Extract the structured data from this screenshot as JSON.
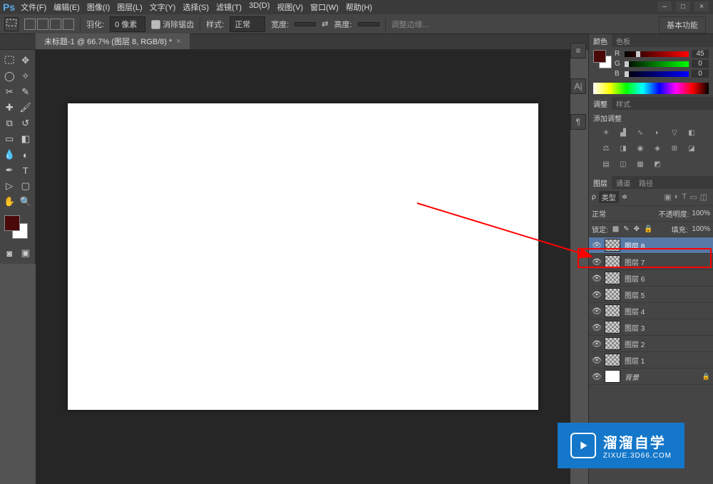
{
  "app": {
    "logo": "Ps"
  },
  "menu": {
    "file": "文件(F)",
    "edit": "编辑(E)",
    "image": "图像(I)",
    "layer": "图层(L)",
    "type": "文字(Y)",
    "select": "选择(S)",
    "filter": "滤镜(T)",
    "threed": "3D(D)",
    "view": "视图(V)",
    "window": "窗口(W)",
    "help": "帮助(H)"
  },
  "options": {
    "feather_label": "羽化:",
    "feather_value": "0 像素",
    "antialias": "消除锯齿",
    "style_label": "样式:",
    "style_value": "正常",
    "width_label": "宽度:",
    "height_label": "高度:",
    "refine": "调整边缘...",
    "essentials": "基本功能"
  },
  "document": {
    "tab_title": "未标题-1 @ 66.7% (图层 8, RGB/8) *",
    "close": "×"
  },
  "color_panel": {
    "tab_color": "颜色",
    "tab_swatches": "色板",
    "r": "R",
    "r_val": "45",
    "g": "G",
    "g_val": "0",
    "b": "B",
    "b_val": "0"
  },
  "adjust_panel": {
    "tab_adjust": "调整",
    "tab_style": "样式",
    "title": "添加调整"
  },
  "layers_panel": {
    "tab_layers": "图层",
    "tab_channels": "通道",
    "tab_paths": "路径",
    "kind_label": "类型",
    "blend_mode": "正常",
    "opacity_label": "不透明度:",
    "opacity_value": "100%",
    "lock_label": "锁定:",
    "fill_label": "填充:",
    "fill_value": "100%",
    "layers": [
      {
        "name": "图层 8",
        "selected": true
      },
      {
        "name": "图层 7",
        "selected": false
      },
      {
        "name": "图层 6",
        "selected": false
      },
      {
        "name": "图层 5",
        "selected": false
      },
      {
        "name": "图层 4",
        "selected": false
      },
      {
        "name": "图层 3",
        "selected": false
      },
      {
        "name": "图层 2",
        "selected": false
      },
      {
        "name": "图层 1",
        "selected": false
      }
    ],
    "background": "背景"
  },
  "watermark": {
    "title": "溜溜自学",
    "url": "ZIXUE.3D66.COM"
  }
}
